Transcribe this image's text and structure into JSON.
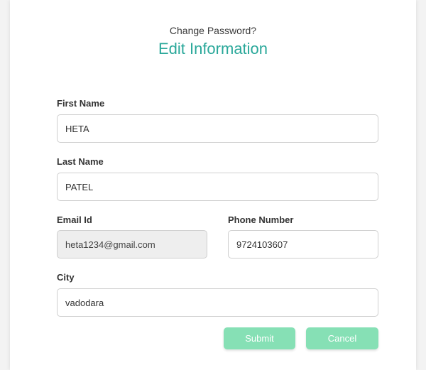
{
  "header": {
    "change_password_link": "Change Password?",
    "title": "Edit Information"
  },
  "form": {
    "first_name": {
      "label": "First Name",
      "value": "HETA"
    },
    "last_name": {
      "label": "Last Name",
      "value": "PATEL"
    },
    "email": {
      "label": "Email Id",
      "value": "heta1234@gmail.com",
      "disabled": true
    },
    "phone": {
      "label": "Phone Number",
      "value": "9724103607"
    },
    "city": {
      "label": "City",
      "value": "vadodara"
    }
  },
  "actions": {
    "submit_label": "Submit",
    "cancel_label": "Cancel"
  },
  "colors": {
    "accent": "#2aa89a",
    "button": "#86e0b5",
    "disabled_field": "#eeeeee"
  }
}
